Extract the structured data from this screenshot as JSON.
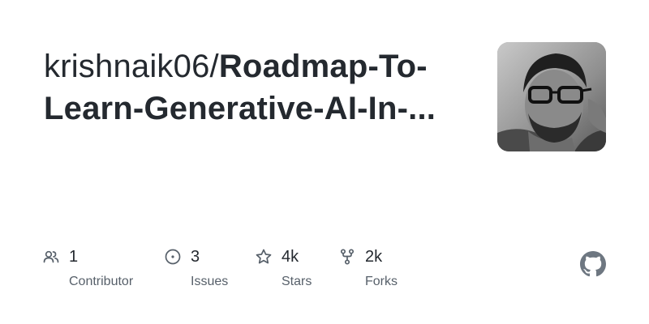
{
  "repo": {
    "owner": "krishnaik06/",
    "name_line1": "Roadmap-To-",
    "name_line2": "Learn-Generative-AI-In-..."
  },
  "stats": [
    {
      "icon": "people-icon",
      "value": "1",
      "label": "Contributor"
    },
    {
      "icon": "issue-icon",
      "value": "3",
      "label": "Issues"
    },
    {
      "icon": "star-icon",
      "value": "4k",
      "label": "Stars"
    },
    {
      "icon": "fork-icon",
      "value": "2k",
      "label": "Forks"
    }
  ],
  "colors": {
    "text": "#24292f",
    "muted": "#57606a",
    "icon": "#57606a",
    "github_logo": "#6e7781"
  },
  "icons": {
    "avatar": "owner-avatar-photo",
    "logo": "github-mark-icon"
  }
}
